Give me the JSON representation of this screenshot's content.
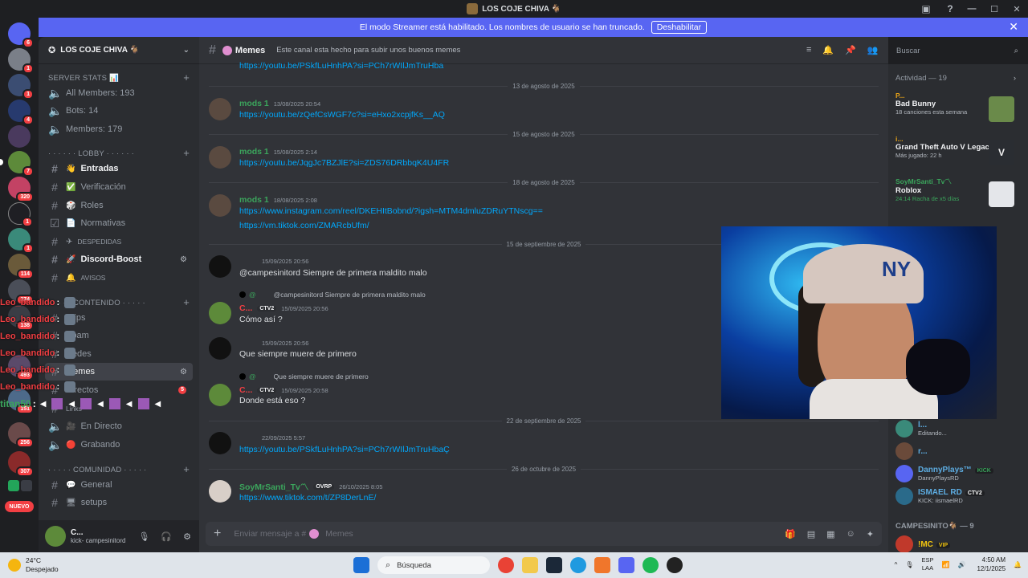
{
  "window": {
    "title": "LOS COJE CHIVA 🐐",
    "controls": [
      "—",
      "☐",
      "✕"
    ]
  },
  "banner": {
    "text": "El modo Streamer está habilitado. Los nombres de usuario se han truncado.",
    "button": "Deshabilitar"
  },
  "guild_badges": [
    "6",
    "1",
    "1",
    "4",
    "7",
    "320",
    "1",
    "1",
    "114",
    "374",
    "138",
    "493",
    "151",
    "256",
    "307"
  ],
  "new_label": "NUEVO",
  "server": {
    "name": "LOS COJE CHIVA 🐐"
  },
  "sidebar": {
    "stats_category": "SERVER STATS 📊",
    "stats": [
      "All Members: 193",
      "Bots: 14",
      "Members: 179"
    ],
    "lobby_category": "· · · · · · LOBBY · · · · · ·",
    "lobby": [
      {
        "emoji": "👋",
        "name": "Entradas"
      },
      {
        "emoji": "✅",
        "name": "Verificación"
      },
      {
        "emoji": "🎲",
        "name": "Roles"
      },
      {
        "emoji": "📄",
        "name": "Normativas"
      },
      {
        "emoji": "✈",
        "name": "DESPEDIDAS"
      },
      {
        "emoji": "🚀",
        "name": "Discord-Boost"
      },
      {
        "emoji": "🔔",
        "name": "AVISOS"
      }
    ],
    "content_category": "· · · · · CONTENIDO · · · · ·",
    "content": [
      {
        "name": "Clips"
      },
      {
        "name": "Spam"
      },
      {
        "name": "Redes"
      },
      {
        "name": "Memes"
      },
      {
        "name": "Directos",
        "badge": "5"
      },
      {
        "name": "Links"
      }
    ],
    "voice": [
      {
        "emoji": "🎥",
        "name": "En Directo"
      },
      {
        "emoji": "🔴",
        "name": "Grabando"
      }
    ],
    "community_category": "· · · · · COMUNIDAD · · · · ·",
    "community": [
      {
        "emoji": "💬",
        "name": "General"
      },
      {
        "emoji": "🖥",
        "name": "setups"
      }
    ]
  },
  "overlay_names": [
    "Leo_bandido",
    "Leo_bandido",
    "Leo_bandido",
    "Leo_bandido",
    "Leo_bandido",
    "Leo_bandido"
  ],
  "overlay_bar_name": "titan50",
  "user": {
    "name": "C...",
    "status": "kick- campesinitord"
  },
  "channel": {
    "name": "Memes",
    "topic": "Este canal esta hecho para subir unos buenos memes",
    "search_placeholder": "Buscar",
    "composer_placeholder": "Enviar mensaje a #",
    "composer_channel": "Memes"
  },
  "messages": {
    "top_link": "https://youtu.be/PSkfLuHnhPA?si=PCh7rWIlJmTruHba",
    "d1": "13 de agosto de 2025",
    "m1": {
      "author": "mods 1",
      "time": "13/08/2025 20:54",
      "link": "https://youtu.be/zQefCsWGF7c?si=eHxo2xcpjfKs__AQ"
    },
    "d2": "15 de agosto de 2025",
    "m2": {
      "author": "mods 1",
      "time": "15/08/2025 2:14",
      "link": "https://youtu.be/JqgJc7BZJlE?si=ZDS76DRbbqK4U4FR"
    },
    "d3": "18 de agosto de 2025",
    "m3": {
      "author": "mods 1",
      "time": "18/08/2025 2:08",
      "link1": "https://www.instagram.com/reel/DKEHItBobnd/?igsh=MTM4dmluZDRuYTNscg==",
      "link2": "https://vm.tiktok.com/ZMARcbUfm/"
    },
    "d4": "15 de septiembre de 2025",
    "m4": {
      "time": "15/09/2025 20:56",
      "text": "@campesinitord  Siempre de primera maldito malo"
    },
    "m5": {
      "reply_at": "@",
      "reply_text": "@campesinitord  Siempre de primera maldito malo",
      "author": "C...",
      "tag": "CTV2",
      "time": "15/09/2025 20:56",
      "text": "Cómo así ?"
    },
    "m6": {
      "time": "15/09/2025 20:56",
      "text": "Que siempre muere de primero"
    },
    "m7": {
      "reply_at": "@",
      "reply_text": "Que siempre muere de primero",
      "author": "C...",
      "tag": "CTV2",
      "time": "15/09/2025 20:58",
      "text": "Donde está eso ?"
    },
    "d5": "22 de septiembre de 2025",
    "m8": {
      "time": "22/09/2025 5:57",
      "link": "https://youtu.be/PSkfLuHnhPA?si=PCh7rWIlJmTruHbaÇ"
    },
    "d6": "26 de octubre de 2025",
    "m9": {
      "author": "SoyMrSanti_Tv〽",
      "tag": "OVRP",
      "time": "26/10/2025 8:05",
      "link": "https://www.tiktok.com/t/ZP8DerLnE/"
    }
  },
  "activity": {
    "header": "Actividad — 19",
    "items": [
      {
        "small": "P...",
        "title": "Bad Bunny",
        "sub": "18 canciones esta semana"
      },
      {
        "small": "i...",
        "title": "Grand Theft Auto V Legacy",
        "sub": "Más jugado: 22 h"
      },
      {
        "small": "SoyMrSanti_Tv〽",
        "title": "Roblox",
        "sub": "24:14  Racha de x5 días"
      }
    ]
  },
  "members": [
    {
      "name": "l...",
      "status": "Editando..."
    },
    {
      "name": "r...",
      "status": ""
    },
    {
      "name": "DannyPlays™",
      "tag": "KICK",
      "status": "DannyPlaysRD"
    },
    {
      "name": "ISMAEL RD",
      "tag": "CTV2",
      "status": "KICK: iismaelRD"
    }
  ],
  "members_cat": "CAMPESINITO🐐 — 9",
  "last_member": {
    "name": "!MC",
    "tag": "VIP"
  },
  "taskbar": {
    "temp": "24°C",
    "weather": "Despejado",
    "search": "Búsqueda",
    "lang1": "ESP",
    "lang2": "LAA",
    "time": "4:50 AM",
    "date": "12/1/2025"
  },
  "colors": {
    "accent": "#5865f2",
    "link": "#00a8fc",
    "mods": "#3ba55c",
    "danger": "#f23f43"
  }
}
